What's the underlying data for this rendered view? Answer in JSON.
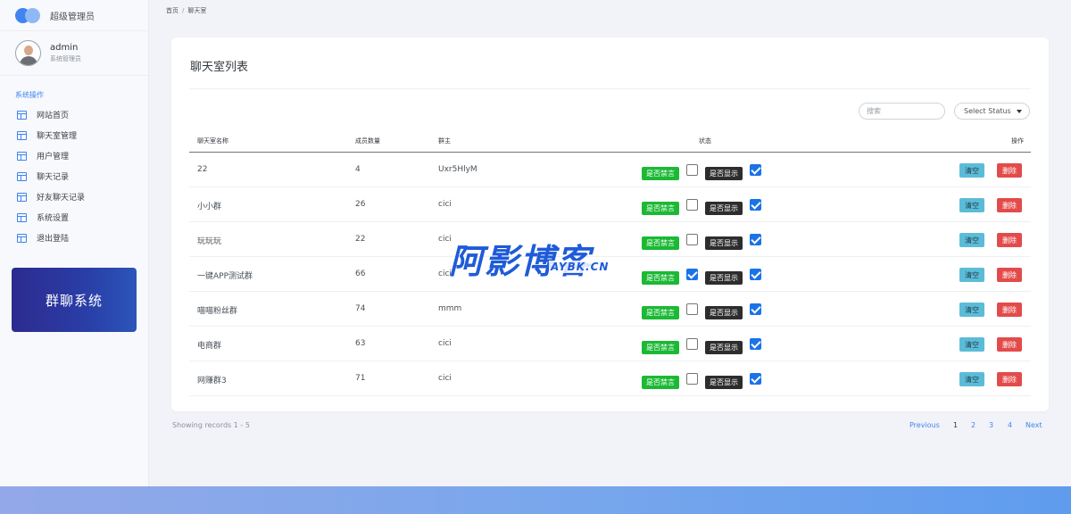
{
  "brand": {
    "title": "超级管理员"
  },
  "user": {
    "name": "admin",
    "role": "系统管理员"
  },
  "nav": {
    "section": "系统操作",
    "items": [
      {
        "label": "网站首页",
        "icon": "layout-icon"
      },
      {
        "label": "聊天室管理",
        "icon": "layout-icon"
      },
      {
        "label": "用户管理",
        "icon": "layout-icon"
      },
      {
        "label": "聊天记录",
        "icon": "layout-icon"
      },
      {
        "label": "好友聊天记录",
        "icon": "layout-icon"
      },
      {
        "label": "系统设置",
        "icon": "layout-icon"
      },
      {
        "label": "退出登陆",
        "icon": "layout-icon"
      }
    ]
  },
  "promo": {
    "text": "群聊系统"
  },
  "breadcrumb": {
    "home": "首页",
    "separator": "/",
    "current": "聊天室"
  },
  "card": {
    "title": "聊天室列表"
  },
  "filters": {
    "search_placeholder": "搜索",
    "status_select": "Select Status"
  },
  "table": {
    "headers": {
      "name": "聊天室名称",
      "members": "成员数量",
      "owner": "群主",
      "status": "状态",
      "actions": "操作"
    },
    "badges": {
      "mute": "是否禁言",
      "show": "是否显示"
    },
    "buttons": {
      "clear": "清空",
      "delete": "删除"
    },
    "rows": [
      {
        "name": "22",
        "members": "4",
        "owner": "Uxr5HlyM",
        "muted": false,
        "shown": true
      },
      {
        "name": "小小群",
        "members": "26",
        "owner": "cici",
        "muted": false,
        "shown": true
      },
      {
        "name": "玩玩玩",
        "members": "22",
        "owner": "cici",
        "muted": false,
        "shown": true
      },
      {
        "name": "一键APP测试群",
        "members": "66",
        "owner": "cici",
        "muted": true,
        "shown": true
      },
      {
        "name": "喵喵粉丝群",
        "members": "74",
        "owner": "mmm",
        "muted": false,
        "shown": true
      },
      {
        "name": "电商群",
        "members": "63",
        "owner": "cici",
        "muted": false,
        "shown": true
      },
      {
        "name": "网赚群3",
        "members": "71",
        "owner": "cici",
        "muted": false,
        "shown": true
      }
    ]
  },
  "footer": {
    "records": "Showing records 1 - 5",
    "pager": {
      "previous": "Previous",
      "pages": [
        "1",
        "2",
        "3",
        "4"
      ],
      "next": "Next"
    }
  },
  "watermark": {
    "cn": "阿影博客",
    "en": "AYBK.CN"
  },
  "colors": {
    "accent": "#3f84f0",
    "mute_badge": "#1bb934",
    "show_badge": "#2d2d2d",
    "clear_button": "#5bbcd8",
    "delete_button": "#e34b4b",
    "checkbox_on": "#1a73e8"
  }
}
